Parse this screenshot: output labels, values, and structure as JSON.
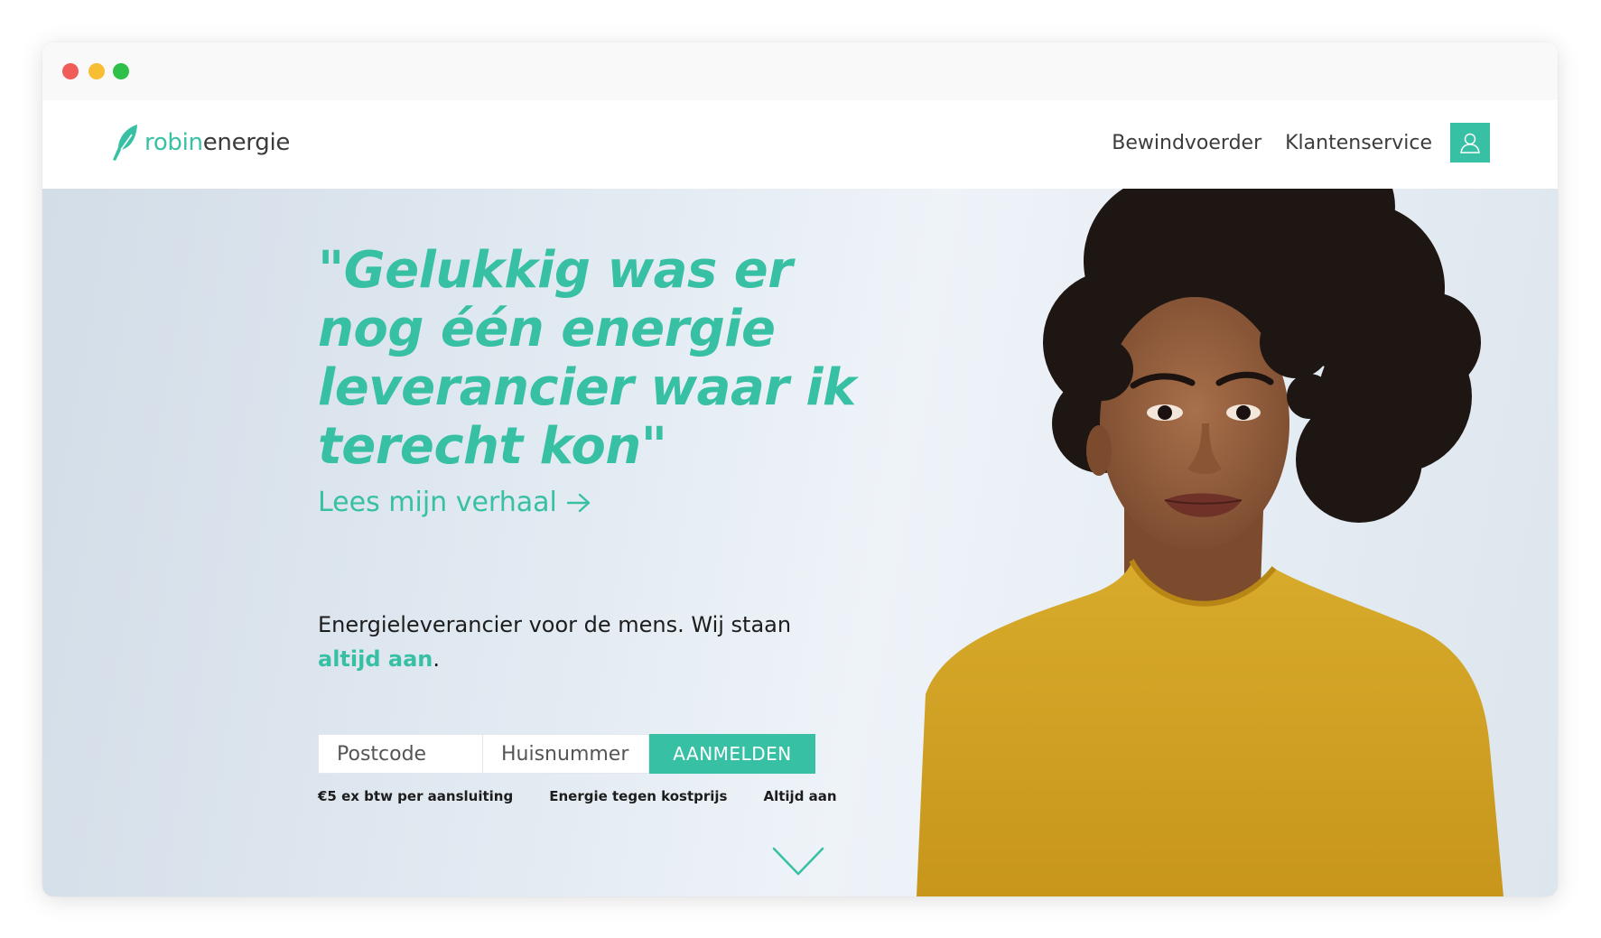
{
  "window": {
    "controls": [
      "close",
      "minimize",
      "maximize"
    ]
  },
  "brand": {
    "name_part1": "robin",
    "name_part2": "energie",
    "color": "#37c0a3",
    "icon": "feather-leaf-icon"
  },
  "nav": {
    "links": [
      {
        "label": "Bewindvoerder"
      },
      {
        "label": "Klantenservice"
      }
    ],
    "account_icon": "user-icon"
  },
  "hero": {
    "quote": "\"Gelukkig was er nog één energie leverancier waar ik terecht kon\"",
    "story_link": "Lees mijn verhaal",
    "story_link_icon": "arrow-right-icon",
    "tagline_text": "Energieleverancier voor de mens. Wij staan ",
    "tagline_highlight": "altijd aan",
    "tagline_end": ".",
    "form": {
      "postcode_placeholder": "Postcode",
      "huisnummer_placeholder": "Huisnummer",
      "submit_label": "AANMELDEN"
    },
    "usps": [
      "€5 ex btw per aansluiting",
      "Energie tegen kostprijs",
      "Altijd aan"
    ],
    "scroll_icon": "chevron-down-icon"
  },
  "colors": {
    "accent": "#37c0a3",
    "sweater": "#d6a724",
    "text": "#1d1d1d"
  }
}
